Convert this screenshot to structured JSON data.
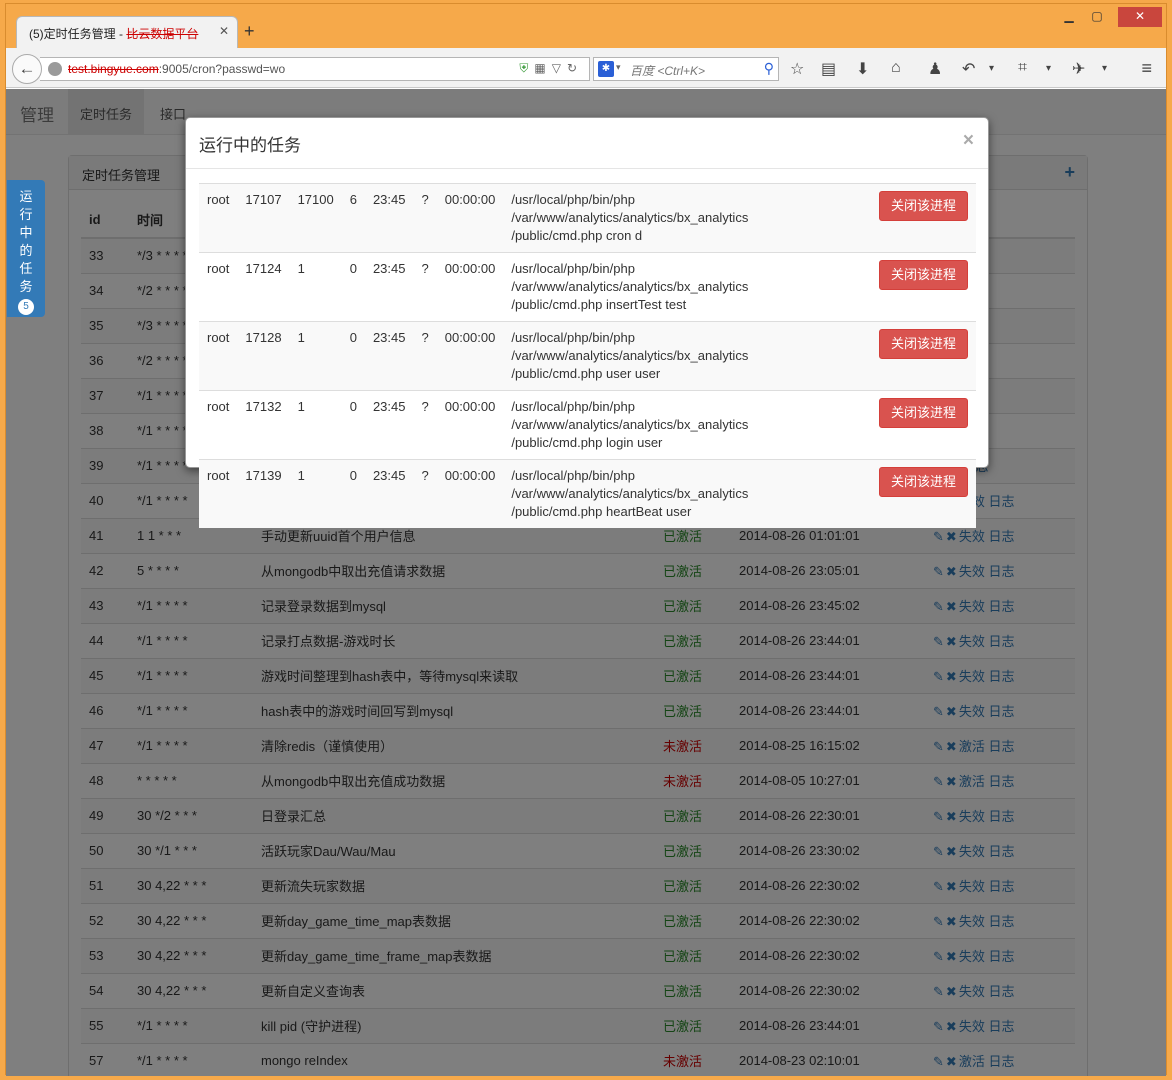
{
  "browser": {
    "tab_title": "(5)定时任务管理 - ",
    "tab_title_redacted": "比云数据平台",
    "new_tab": "+",
    "url_redacted": "test.bingyue.com",
    "url_rest": ":9005/cron?passwd=wo",
    "search_placeholder": "百度 <Ctrl+K>"
  },
  "app": {
    "brand": "管理",
    "nav": [
      {
        "label": "定时任务"
      },
      {
        "label": "接口"
      }
    ]
  },
  "side_float": {
    "label": "运行中的任务",
    "count": "5"
  },
  "panel": {
    "title": "定时任务管理",
    "headers": [
      "id",
      "时间",
      "",
      "",
      "",
      ""
    ]
  },
  "jobs": [
    {
      "id": "33",
      "time": "*/3 * * * *",
      "desc": "",
      "status": "",
      "date": "",
      "toggle": "",
      "log": "日志"
    },
    {
      "id": "34",
      "time": "*/2 * * * *",
      "desc": "",
      "status": "",
      "date": "",
      "toggle": "",
      "log": "日志"
    },
    {
      "id": "35",
      "time": "*/3 * * * *",
      "desc": "",
      "status": "",
      "date": "",
      "toggle": "",
      "log": "日志"
    },
    {
      "id": "36",
      "time": "*/2 * * * *",
      "desc": "",
      "status": "",
      "date": "",
      "toggle": "",
      "log": "日志"
    },
    {
      "id": "37",
      "time": "*/1 * * * *",
      "desc": "",
      "status": "",
      "date": "",
      "toggle": "",
      "log": "日志"
    },
    {
      "id": "38",
      "time": "*/1 * * * *",
      "desc": "",
      "status": "",
      "date": "",
      "toggle": "",
      "log": "日志"
    },
    {
      "id": "39",
      "time": "*/1 * * * *",
      "desc": "",
      "status": "",
      "date": "",
      "toggle": "",
      "log": "日志"
    },
    {
      "id": "40",
      "time": "*/1 * * * *",
      "desc": "注册user",
      "status": "已激活",
      "date": "2014-08-26 23:45:02",
      "toggle": "失效",
      "log": "日志"
    },
    {
      "id": "41",
      "time": "1 1 * * *",
      "desc": "手动更新uuid首个用户信息",
      "status": "已激活",
      "date": "2014-08-26 01:01:01",
      "toggle": "失效",
      "log": "日志"
    },
    {
      "id": "42",
      "time": "5 * * * *",
      "desc": "从mongodb中取出充值请求数据",
      "status": "已激活",
      "date": "2014-08-26 23:05:01",
      "toggle": "失效",
      "log": "日志"
    },
    {
      "id": "43",
      "time": "*/1 * * * *",
      "desc": "记录登录数据到mysql",
      "status": "已激活",
      "date": "2014-08-26 23:45:02",
      "toggle": "失效",
      "log": "日志"
    },
    {
      "id": "44",
      "time": "*/1 * * * *",
      "desc": "记录打点数据-游戏时长",
      "status": "已激活",
      "date": "2014-08-26 23:44:01",
      "toggle": "失效",
      "log": "日志"
    },
    {
      "id": "45",
      "time": "*/1 * * * *",
      "desc": "游戏时间整理到hash表中，等待mysql来读取",
      "status": "已激活",
      "date": "2014-08-26 23:44:01",
      "toggle": "失效",
      "log": "日志"
    },
    {
      "id": "46",
      "time": "*/1 * * * *",
      "desc": "hash表中的游戏时间回写到mysql",
      "status": "已激活",
      "date": "2014-08-26 23:44:01",
      "toggle": "失效",
      "log": "日志"
    },
    {
      "id": "47",
      "time": "*/1 * * * *",
      "desc": "清除redis（谨慎使用）",
      "status": "未激活",
      "date": "2014-08-25 16:15:02",
      "toggle": "激活",
      "log": "日志"
    },
    {
      "id": "48",
      "time": "* * * * *",
      "desc": "从mongodb中取出充值成功数据",
      "status": "未激活",
      "date": "2014-08-05 10:27:01",
      "toggle": "激活",
      "log": "日志"
    },
    {
      "id": "49",
      "time": "30 */2 * * *",
      "desc": "日登录汇总",
      "status": "已激活",
      "date": "2014-08-26 22:30:01",
      "toggle": "失效",
      "log": "日志"
    },
    {
      "id": "50",
      "time": "30 */1 * * *",
      "desc": "活跃玩家Dau/Wau/Mau",
      "status": "已激活",
      "date": "2014-08-26 23:30:02",
      "toggle": "失效",
      "log": "日志"
    },
    {
      "id": "51",
      "time": "30 4,22 * * *",
      "desc": "更新流失玩家数据",
      "status": "已激活",
      "date": "2014-08-26 22:30:02",
      "toggle": "失效",
      "log": "日志"
    },
    {
      "id": "52",
      "time": "30 4,22 * * *",
      "desc": "更新day_game_time_map表数据",
      "status": "已激活",
      "date": "2014-08-26 22:30:02",
      "toggle": "失效",
      "log": "日志"
    },
    {
      "id": "53",
      "time": "30 4,22 * * *",
      "desc": "更新day_game_time_frame_map表数据",
      "status": "已激活",
      "date": "2014-08-26 22:30:02",
      "toggle": "失效",
      "log": "日志"
    },
    {
      "id": "54",
      "time": "30 4,22 * * *",
      "desc": "更新自定义查询表",
      "status": "已激活",
      "date": "2014-08-26 22:30:02",
      "toggle": "失效",
      "log": "日志"
    },
    {
      "id": "55",
      "time": "*/1 * * * *",
      "desc": "kill pid (守护进程)",
      "status": "已激活",
      "date": "2014-08-26 23:44:01",
      "toggle": "失效",
      "log": "日志"
    },
    {
      "id": "57",
      "time": "*/1 * * * *",
      "desc": "mongo reIndex",
      "status": "未激活",
      "date": "2014-08-23 02:10:01",
      "toggle": "激活",
      "log": "日志"
    }
  ],
  "modal": {
    "title": "运行中的任务",
    "close": "×",
    "processes": [
      {
        "user": "root",
        "pid": "17107",
        "ppid": "17100",
        "c": "6",
        "stime": "23:45",
        "tty": "?",
        "time": "00:00:00",
        "cmd1": "/usr/local/php/bin/php /var/www/analytics/analytics/bx_analytics",
        "cmd2": "/public/cmd.php cron d",
        "button": "关闭该进程"
      },
      {
        "user": "root",
        "pid": "17124",
        "ppid": "1",
        "c": "0",
        "stime": "23:45",
        "tty": "?",
        "time": "00:00:00",
        "cmd1": "/usr/local/php/bin/php /var/www/analytics/analytics/bx_analytics",
        "cmd2": "/public/cmd.php insertTest test",
        "button": "关闭该进程"
      },
      {
        "user": "root",
        "pid": "17128",
        "ppid": "1",
        "c": "0",
        "stime": "23:45",
        "tty": "?",
        "time": "00:00:00",
        "cmd1": "/usr/local/php/bin/php /var/www/analytics/analytics/bx_analytics",
        "cmd2": "/public/cmd.php user user",
        "button": "关闭该进程"
      },
      {
        "user": "root",
        "pid": "17132",
        "ppid": "1",
        "c": "0",
        "stime": "23:45",
        "tty": "?",
        "time": "00:00:00",
        "cmd1": "/usr/local/php/bin/php /var/www/analytics/analytics/bx_analytics",
        "cmd2": "/public/cmd.php login user",
        "button": "关闭该进程"
      },
      {
        "user": "root",
        "pid": "17139",
        "ppid": "1",
        "c": "0",
        "stime": "23:45",
        "tty": "?",
        "time": "00:00:00",
        "cmd1": "/usr/local/php/bin/php /var/www/analytics/analytics/bx_analytics",
        "cmd2": "/public/cmd.php heartBeat user",
        "button": "关闭该进程"
      }
    ]
  }
}
